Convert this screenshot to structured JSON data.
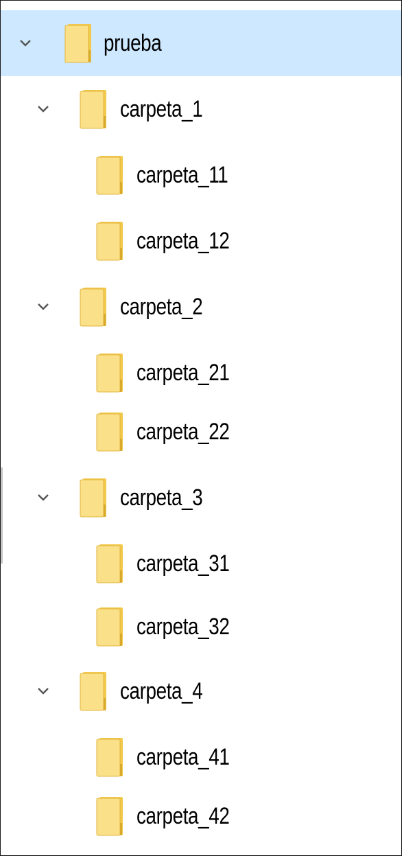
{
  "tree": {
    "icons": {
      "expand": "chevron-down-icon",
      "folder": "folder-icon"
    },
    "colors": {
      "selection": "#cde8ff",
      "folder_fill": "#fbe08a",
      "folder_back": "#f2c94c",
      "chevron": "#555555",
      "text": "#000000"
    },
    "root": {
      "label": "prueba",
      "expanded": true,
      "selected": true
    },
    "folders": [
      {
        "label": "carpeta_1",
        "expanded": true,
        "children": [
          {
            "label": "carpeta_11"
          },
          {
            "label": "carpeta_12"
          }
        ]
      },
      {
        "label": "carpeta_2",
        "expanded": true,
        "children": [
          {
            "label": "carpeta_21"
          },
          {
            "label": "carpeta_22"
          }
        ]
      },
      {
        "label": "carpeta_3",
        "expanded": true,
        "children": [
          {
            "label": "carpeta_31"
          },
          {
            "label": "carpeta_32"
          }
        ]
      },
      {
        "label": "carpeta_4",
        "expanded": true,
        "children": [
          {
            "label": "carpeta_41"
          },
          {
            "label": "carpeta_42"
          }
        ]
      }
    ]
  }
}
